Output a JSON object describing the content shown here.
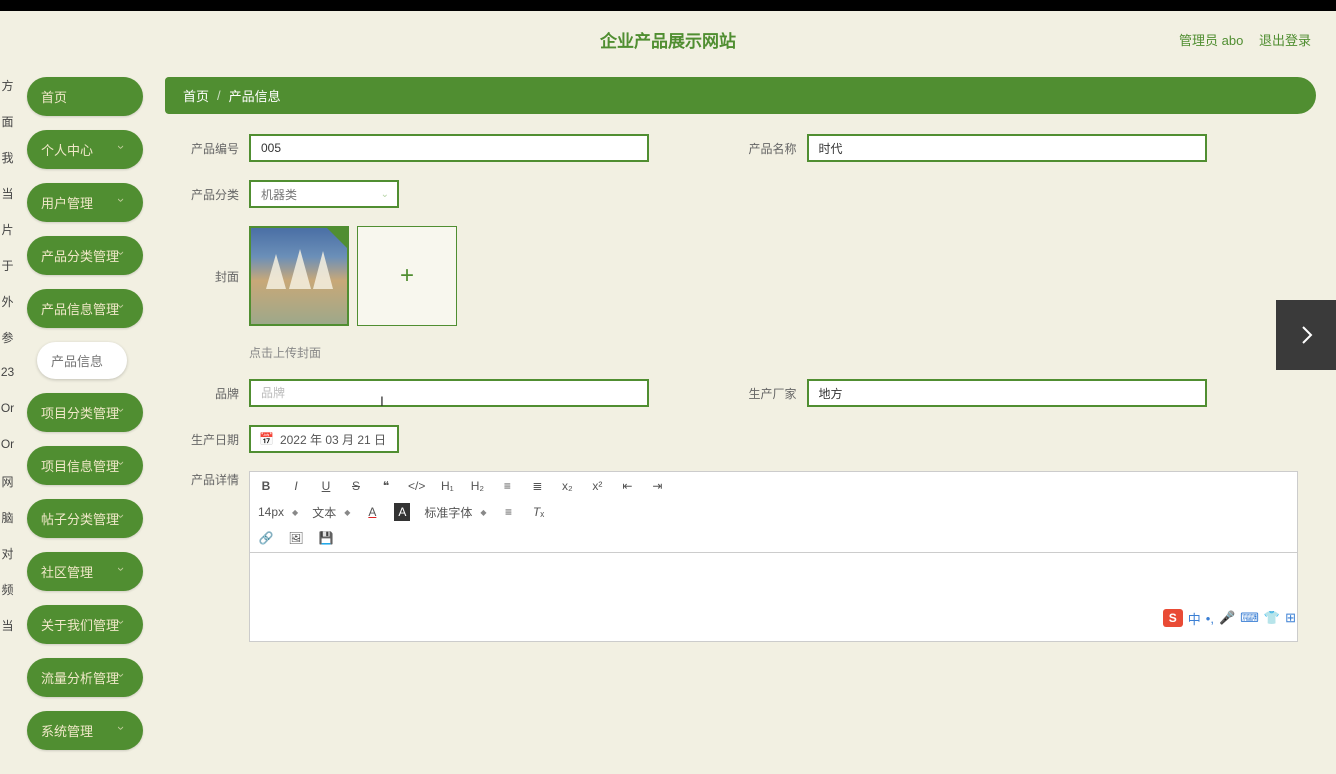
{
  "header": {
    "title": "企业产品展示网站",
    "admin_label": "管理员 abo",
    "logout_label": "退出登录"
  },
  "left_strip": [
    "方",
    "面",
    "我",
    "当",
    "片",
    "于",
    "外",
    "参",
    "23",
    "Or",
    "Or",
    "网",
    "脑",
    "对",
    "频",
    "当"
  ],
  "sidebar": {
    "items": [
      {
        "label": "首页",
        "expandable": false
      },
      {
        "label": "个人中心",
        "expandable": true
      },
      {
        "label": "用户管理",
        "expandable": true
      },
      {
        "label": "产品分类管理",
        "expandable": true
      },
      {
        "label": "产品信息管理",
        "expandable": true,
        "open": true,
        "sub": [
          {
            "label": "产品信息"
          }
        ]
      },
      {
        "label": "项目分类管理",
        "expandable": true
      },
      {
        "label": "项目信息管理",
        "expandable": true
      },
      {
        "label": "帖子分类管理",
        "expandable": true
      },
      {
        "label": "社区管理",
        "expandable": true
      },
      {
        "label": "关于我们管理",
        "expandable": true
      },
      {
        "label": "流量分析管理",
        "expandable": true
      },
      {
        "label": "系统管理",
        "expandable": true
      }
    ]
  },
  "breadcrumb": {
    "home": "首页",
    "current": "产品信息"
  },
  "form": {
    "product_code": {
      "label": "产品编号",
      "value": "005"
    },
    "product_name": {
      "label": "产品名称",
      "value": "时代"
    },
    "product_cat": {
      "label": "产品分类",
      "value": "机器类"
    },
    "cover": {
      "label": "封面",
      "hint": "点击上传封面"
    },
    "brand": {
      "label": "品牌",
      "value": "",
      "placeholder": "品牌"
    },
    "manufacturer": {
      "label": "生产厂家",
      "value": "地方"
    },
    "prod_date": {
      "label": "生产日期",
      "value": "2022 年 03 月 21 日"
    },
    "detail": {
      "label": "产品详情"
    }
  },
  "editor": {
    "font_size": "14px",
    "text_mode": "文本",
    "font_family": "标准字体"
  },
  "ime": {
    "logo": "S",
    "lang": "中"
  }
}
